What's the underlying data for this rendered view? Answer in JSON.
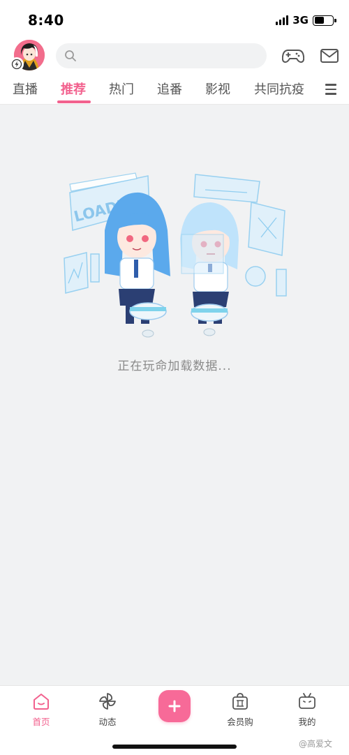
{
  "status_bar": {
    "time": "8:40",
    "network": "3G",
    "battery_level": 0.55
  },
  "header": {
    "avatar": "anime-character-avatar",
    "search_placeholder": "",
    "icons": [
      "search-icon",
      "gamepad-icon",
      "mail-icon",
      "bolt-badge-icon"
    ]
  },
  "tabs": {
    "items": [
      {
        "label": "直播"
      },
      {
        "label": "推荐",
        "active": true
      },
      {
        "label": "热门"
      },
      {
        "label": "追番"
      },
      {
        "label": "影视"
      },
      {
        "label": "共同抗疫"
      }
    ],
    "menu_icon": "menu-icon"
  },
  "content": {
    "illustration_text": "LOADING",
    "loading_message": "正在玩命加载数据..."
  },
  "bottom_nav": {
    "items": [
      {
        "label": "首页",
        "icon": "home-icon",
        "active": true
      },
      {
        "label": "动态",
        "icon": "pinwheel-icon"
      },
      {
        "label": "",
        "icon": "plus-icon"
      },
      {
        "label": "会员购",
        "icon": "shopping-bag-icon"
      },
      {
        "label": "我的",
        "icon": "tv-icon"
      }
    ],
    "watermark": "@高爱文"
  },
  "colors": {
    "accent": "#f2618e",
    "background": "#f1f2f3",
    "illustration_blue": "#5ba9ec"
  }
}
